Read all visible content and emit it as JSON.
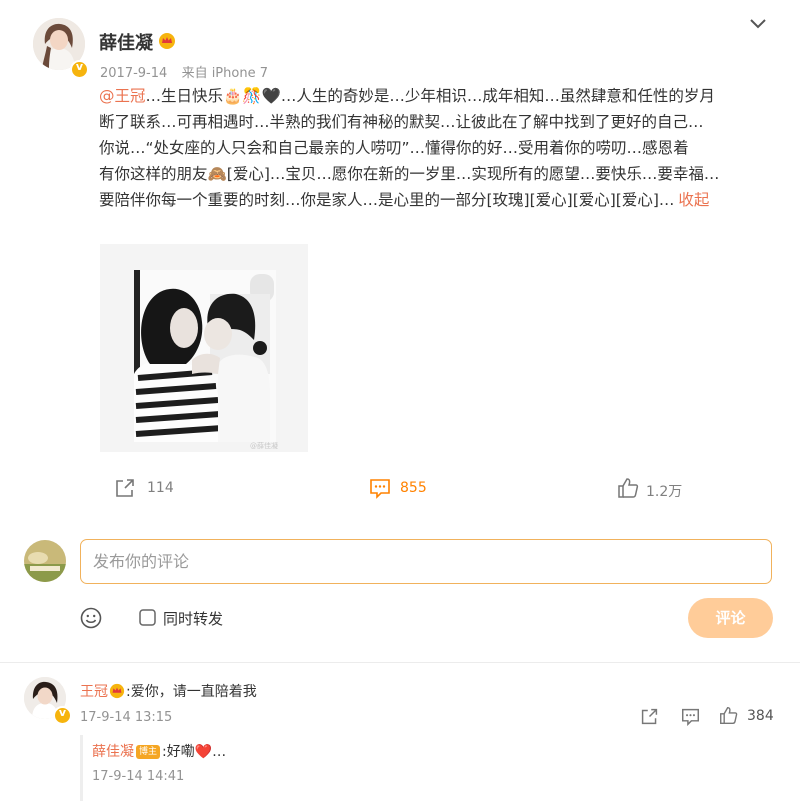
{
  "post": {
    "author": "薛佳凝",
    "date": "2017-9-14",
    "source": "来自 iPhone 7",
    "mention": "@王冠",
    "line1": "…生日快乐🎂🎊🖤…人生的奇妙是…少年相识…成年相知…虽然肆意和任性的岁月",
    "line2": "断了联系…可再相遇时…半熟的我们有神秘的默契…让彼此在了解中找到了更好的自己…",
    "line3": "你说…“处女座的人只会和自己最亲的人唠叨”…懂得你的好…受用着你的唠叨…感恩着",
    "line4": "有你这样的朋友🙈[爱心]…宝贝…愿你在新的一岁里…实现所有的愿望…要快乐…要幸福…",
    "line5": "要陪伴你每一个重要的时刻…你是家人…是心里的一部分[玫瑰][爱心][爱心][爱心]…",
    "collapse": "收起",
    "watermark": "@薛佳凝",
    "reposts": "114",
    "comments": "855",
    "likes": "1.2万"
  },
  "composer": {
    "placeholder": "发布你的评论",
    "also_repost": "同时转发",
    "submit": "评论"
  },
  "comments": [
    {
      "author": "王冠",
      "text": "爱你，请一直陪着我",
      "time": "17-9-14 13:15",
      "likes": "384"
    }
  ],
  "reply": {
    "author": "薛佳凝",
    "badge": "博主",
    "text": "好嘞❤️…",
    "time": "17-9-14 14:41"
  },
  "colors": {
    "accent": "#ff8200",
    "link": "#eb7350",
    "verified": "#f6b40e",
    "input_border": "#f1b25c",
    "button": "#ffcc99"
  },
  "icons": [
    "chevron-down-icon",
    "verified-icon",
    "repost-icon",
    "comment-icon",
    "like-icon",
    "emoji-icon",
    "checkbox-icon"
  ]
}
